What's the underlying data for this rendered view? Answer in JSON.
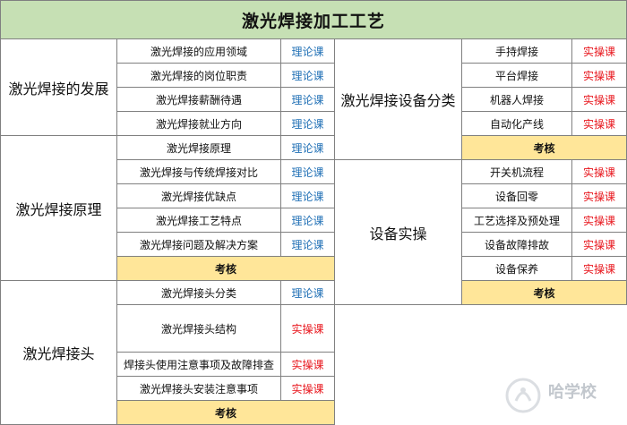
{
  "title": "激光焊接加工工艺",
  "labels": {
    "theory": "理论课",
    "practice": "实操课",
    "exam": "考核"
  },
  "left": {
    "sections": [
      {
        "name": "激光焊接的发展",
        "topics": [
          {
            "name": "激光焊接的应用领域",
            "type": "理论课"
          },
          {
            "name": "激光焊接的岗位职责",
            "type": "理论课"
          },
          {
            "name": "激光焊接薪酬待遇",
            "type": "理论课"
          },
          {
            "name": "激光焊接就业方向",
            "type": "理论课"
          }
        ]
      },
      {
        "name": "激光焊接原理",
        "topics": [
          {
            "name": "激光焊接原理",
            "type": "理论课"
          },
          {
            "name": "激光焊接与传统焊接对比",
            "type": "理论课"
          },
          {
            "name": "激光焊接优缺点",
            "type": "理论课"
          },
          {
            "name": "激光焊接工艺特点",
            "type": "理论课"
          },
          {
            "name": "激光焊接问题及解决方案",
            "type": "理论课"
          }
        ],
        "exam": "考核"
      },
      {
        "name": "激光焊接头",
        "topics": [
          {
            "name": "激光焊接头分类",
            "type": "理论课"
          },
          {
            "name": "激光焊接头结构",
            "type": "实操课"
          },
          {
            "name": "焊接头使用注意事项及故障排查",
            "type": "实操课"
          },
          {
            "name": "激光焊接头安装注意事项",
            "type": "实操课"
          }
        ],
        "exam": "考核"
      }
    ]
  },
  "right": {
    "sections": [
      {
        "name": "激光焊接设备分类",
        "topics": [
          {
            "name": "手持焊接",
            "type": "实操课"
          },
          {
            "name": "平台焊接",
            "type": "实操课"
          },
          {
            "name": "机器人焊接",
            "type": "实操课"
          },
          {
            "name": "自动化产线",
            "type": "实操课"
          }
        ],
        "exam": "考核"
      },
      {
        "name": "设备实操",
        "topics": [
          {
            "name": "开关机流程",
            "type": "实操课"
          },
          {
            "name": "设备回零",
            "type": "实操课"
          },
          {
            "name": "工艺选择及预处理",
            "type": "实操课"
          },
          {
            "name": "设备故障排故",
            "type": "实操课"
          },
          {
            "name": "设备保养",
            "type": "实操课"
          }
        ],
        "exam": "考核"
      }
    ]
  },
  "watermark": "哈学校"
}
